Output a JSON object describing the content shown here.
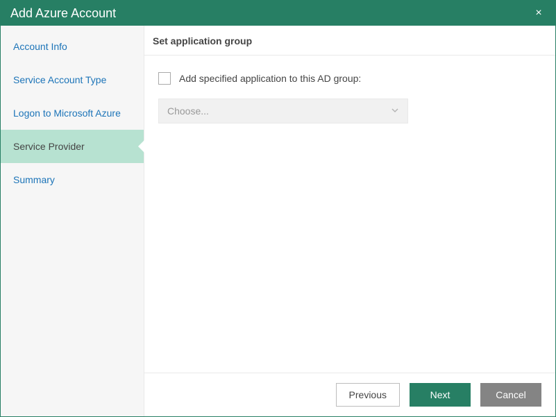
{
  "window": {
    "title": "Add Azure Account",
    "close_label": "×"
  },
  "sidebar": {
    "steps": [
      {
        "label": "Account Info"
      },
      {
        "label": "Service Account Type"
      },
      {
        "label": "Logon to Microsoft Azure"
      },
      {
        "label": "Service Provider"
      },
      {
        "label": "Summary"
      }
    ],
    "active_index": 3
  },
  "main": {
    "header": "Set application group",
    "checkbox_label": "Add specified application to this AD group:",
    "checkbox_checked": false,
    "dropdown_placeholder": "Choose..."
  },
  "footer": {
    "previous": "Previous",
    "next": "Next",
    "cancel": "Cancel"
  }
}
